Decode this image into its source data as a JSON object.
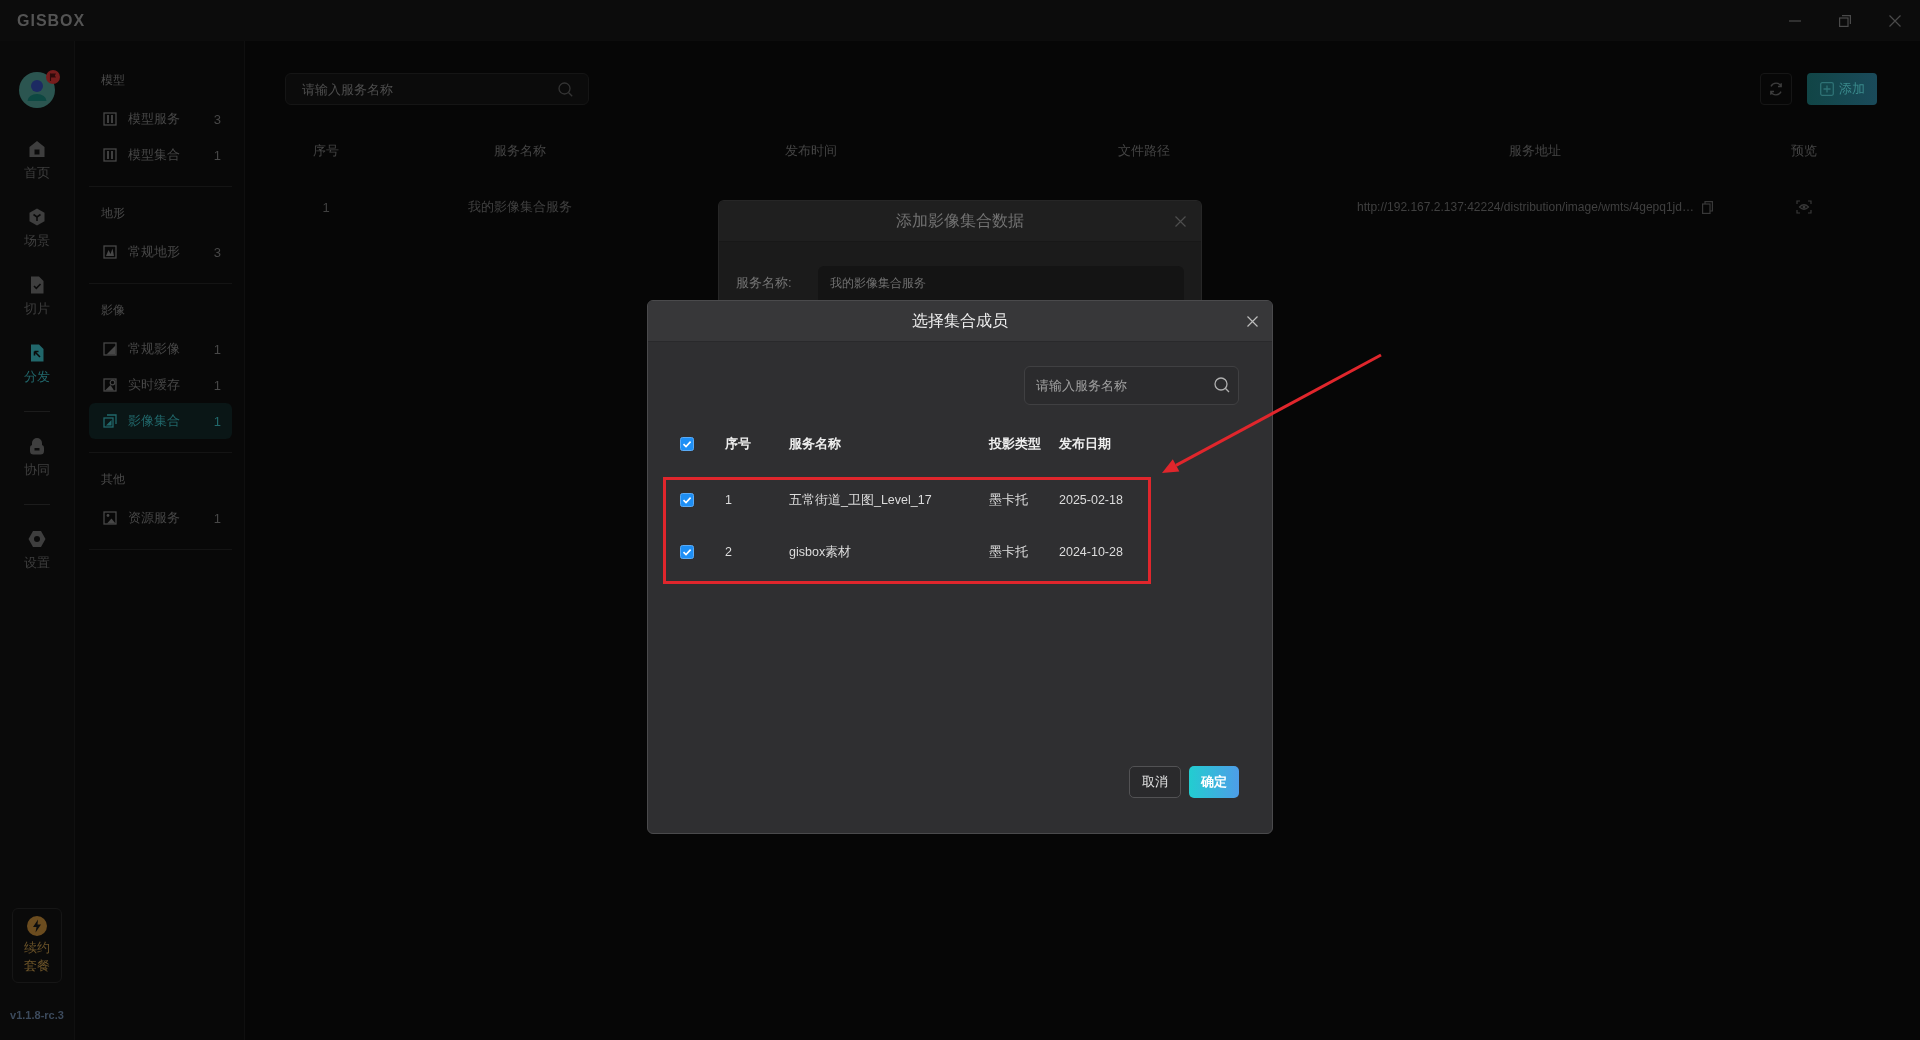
{
  "app": {
    "logo": "GISBOX"
  },
  "rail": {
    "user": {
      "badge": true
    },
    "groups": [
      {
        "items": [
          {
            "label": "首页",
            "selected": false
          },
          {
            "label": "场景",
            "selected": false
          },
          {
            "label": "切片",
            "selected": false
          },
          {
            "label": "分发",
            "selected": true
          }
        ]
      },
      {
        "items": [
          {
            "label": "协同",
            "selected": false
          }
        ]
      },
      {
        "items": [
          {
            "label": "设置",
            "selected": false
          }
        ]
      }
    ],
    "renew": "续约套餐",
    "version": "v1.1.8-rc.3"
  },
  "sidebar": {
    "sections": [
      {
        "title": "模型",
        "items": [
          {
            "label": "模型服务",
            "count": "3",
            "selected": false
          },
          {
            "label": "模型集合",
            "count": "1",
            "selected": false
          }
        ]
      },
      {
        "title": "地形",
        "items": [
          {
            "label": "常规地形",
            "count": "3",
            "selected": false
          }
        ]
      },
      {
        "title": "影像",
        "items": [
          {
            "label": "常规影像",
            "count": "1",
            "selected": false
          },
          {
            "label": "实时缓存",
            "count": "1",
            "selected": false
          },
          {
            "label": "影像集合",
            "count": "1",
            "selected": true
          }
        ]
      },
      {
        "title": "其他",
        "items": [
          {
            "label": "资源服务",
            "count": "1",
            "selected": false
          }
        ]
      }
    ]
  },
  "toolbar": {
    "search": {
      "placeholder": "请输入服务名称"
    },
    "add_button": "添加"
  },
  "table": {
    "columns": [
      "序号",
      "服务名称",
      "发布时间",
      "文件路径",
      "服务地址",
      "预览"
    ],
    "rows": [
      {
        "index": "1",
        "name": "我的影像集合服务",
        "url": "http://192.167.2.137:42224/distribution/image/wmts/4gepq1jd…"
      }
    ]
  },
  "add_dialog": {
    "title": "添加影像集合数据",
    "fields": [
      {
        "label": "服务名称:",
        "value": "我的影像集合服务"
      }
    ]
  },
  "member_dialog": {
    "title": "选择集合成员",
    "search": {
      "placeholder": "请输入服务名称"
    },
    "all_checked": true,
    "columns": [
      "序号",
      "服务名称",
      "投影类型",
      "发布日期"
    ],
    "rows": [
      {
        "index": "1",
        "name": "五常街道_卫图_Level_17",
        "projection": "墨卡托",
        "date": "2025-02-18",
        "checked": true
      },
      {
        "index": "2",
        "name": "gisbox素材",
        "projection": "墨卡托",
        "date": "2024-10-28",
        "checked": true
      }
    ],
    "buttons": [
      {
        "label": "取消",
        "kind": "secondary"
      },
      {
        "label": "确定",
        "kind": "primary"
      }
    ]
  }
}
